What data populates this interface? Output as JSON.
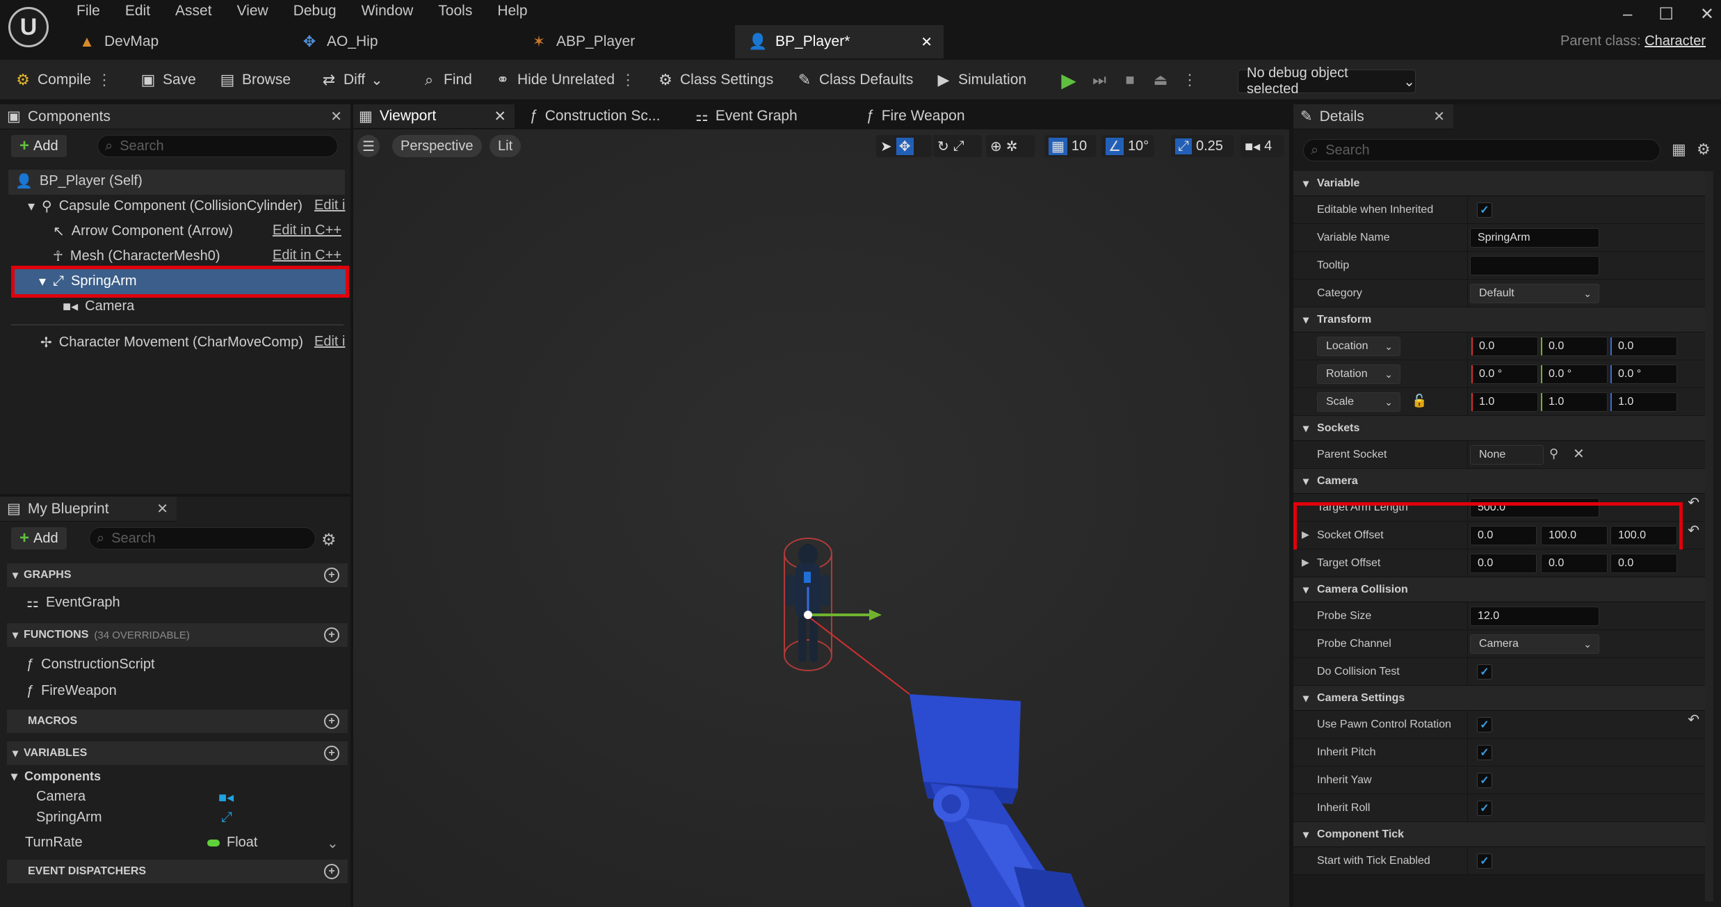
{
  "menubar": {
    "logo": "U",
    "items": [
      "File",
      "Edit",
      "Asset",
      "View",
      "Debug",
      "Window",
      "Tools",
      "Help"
    ]
  },
  "window_controls": {
    "minimize": "–",
    "maximize": "☐",
    "close": "✕"
  },
  "doc_tabs": [
    {
      "label": "DevMap",
      "icon": "map-icon"
    },
    {
      "label": "AO_Hip",
      "icon": "aim-offset-icon"
    },
    {
      "label": "ABP_Player",
      "icon": "anim-blueprint-icon"
    },
    {
      "label": "BP_Player*",
      "icon": "blueprint-icon",
      "active": true
    }
  ],
  "parent_class": {
    "label": "Parent class:",
    "value": "Character"
  },
  "toolbar": {
    "compile": "Compile",
    "save": "Save",
    "browse": "Browse",
    "diff": "Diff",
    "find": "Find",
    "hide_unrelated": "Hide Unrelated",
    "class_settings": "Class Settings",
    "class_defaults": "Class Defaults",
    "simulation": "Simulation",
    "debug_object": "No debug object selected"
  },
  "components_panel": {
    "title": "Components",
    "add": "Add",
    "search_placeholder": "Search",
    "items": [
      {
        "label": "BP_Player (Self)"
      },
      {
        "label": "Capsule Component (CollisionCylinder)",
        "edit": "Edit i"
      },
      {
        "label": "Arrow Component (Arrow)",
        "edit": "Edit in C++"
      },
      {
        "label": "Mesh (CharacterMesh0)",
        "edit": "Edit in C++"
      },
      {
        "label": "SpringArm",
        "selected": true
      },
      {
        "label": "Camera"
      },
      {
        "label": "Character Movement (CharMoveComp)",
        "edit": "Edit i"
      }
    ]
  },
  "my_blueprint": {
    "title": "My Blueprint",
    "add": "Add",
    "search_placeholder": "Search",
    "graphs": {
      "header": "GRAPHS",
      "items": [
        "EventGraph"
      ]
    },
    "functions": {
      "header": "FUNCTIONS",
      "overridable": "(34 OVERRIDABLE)",
      "items": [
        "ConstructionScript",
        "FireWeapon"
      ]
    },
    "macros": {
      "header": "MACROS"
    },
    "variables": {
      "header": "VARIABLES",
      "group": "Components",
      "items": [
        "Camera",
        "SpringArm"
      ],
      "turnrate": {
        "name": "TurnRate",
        "type": "Float"
      }
    },
    "dispatchers": {
      "header": "EVENT DISPATCHERS"
    }
  },
  "editor_tabs": [
    "Viewport",
    "Construction Sc...",
    "Event Graph",
    "Fire Weapon"
  ],
  "viewport": {
    "perspective": "Perspective",
    "lit": "Lit",
    "grid": "10",
    "angle": "10°",
    "scale": "0.25",
    "camera_speed": "4"
  },
  "details": {
    "title": "Details",
    "search_placeholder": "Search",
    "variable": {
      "header": "Variable",
      "editable_label": "Editable when Inherited",
      "name_label": "Variable Name",
      "name_value": "SpringArm",
      "tooltip_label": "Tooltip",
      "category_label": "Category",
      "category_value": "Default"
    },
    "transform": {
      "header": "Transform",
      "location": "Location",
      "rotation": "Rotation",
      "scale": "Scale",
      "loc": [
        "0.0",
        "0.0",
        "0.0"
      ],
      "rot": [
        "0.0 °",
        "0.0 °",
        "0.0 °"
      ],
      "scl": [
        "1.0",
        "1.0",
        "1.0"
      ]
    },
    "sockets": {
      "header": "Sockets",
      "parent_label": "Parent Socket",
      "parent_value": "None"
    },
    "camera": {
      "header": "Camera",
      "arm_label": "Target Arm Length",
      "arm_value": "500.0",
      "socket_label": "Socket Offset",
      "socket": [
        "0.0",
        "100.0",
        "100.0"
      ],
      "target_label": "Target Offset",
      "target": [
        "0.0",
        "0.0",
        "0.0"
      ]
    },
    "collision": {
      "header": "Camera Collision",
      "probe_size_label": "Probe Size",
      "probe_size": "12.0",
      "probe_channel_label": "Probe Channel",
      "probe_channel": "Camera",
      "do_test_label": "Do Collision Test"
    },
    "settings": {
      "header": "Camera Settings",
      "pawn_rot": "Use Pawn Control Rotation",
      "pitch": "Inherit Pitch",
      "yaw": "Inherit Yaw",
      "roll": "Inherit Roll"
    },
    "tick": {
      "header": "Component Tick",
      "start": "Start with Tick Enabled"
    }
  },
  "colors": {
    "accent_green": "#5fbf3f",
    "highlight_red": "#e0000b",
    "selection": "#3b5e8a",
    "axis_x": "#d23030",
    "axis_y": "#6fb32f",
    "axis_z": "#3b6ad8",
    "mesh_blue": "#2a47c7"
  }
}
